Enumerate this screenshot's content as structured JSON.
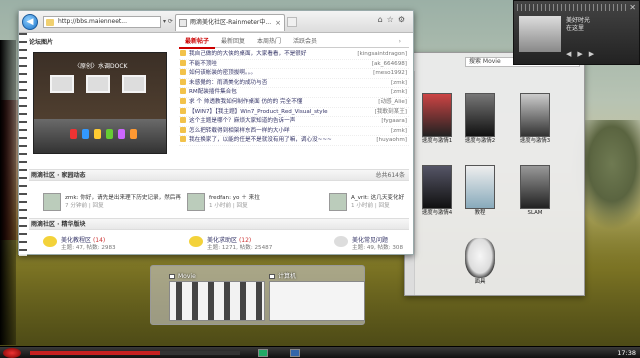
{
  "browser": {
    "address_value": "http://bbs.maienneet...",
    "tab_title": "雨滴美化社区-Rainmeter中...",
    "left_section_title": "论坛图片",
    "gallery_caption": "〈原创〉水调DOCK",
    "tabs": [
      {
        "label": "最新帖子",
        "active": true
      },
      {
        "label": "最新回复",
        "active": false
      },
      {
        "label": "本周热门",
        "active": false
      },
      {
        "label": "活跃会员",
        "active": false
      }
    ],
    "posts": [
      {
        "title": "我自己做的的大侠的桌面，大家看看，不是很好",
        "user": "[kingsaintdragon]"
      },
      {
        "title": "不能不顶哇",
        "user": "[ak_664698]"
      },
      {
        "title": "如何该帐装的密顶拔啊。。。",
        "user": "[meso1992]"
      },
      {
        "title": "未感覺的：雨滴美化的成功与否",
        "user": "[zmk]"
      },
      {
        "title": "RM配装插件集合包",
        "user": "[zmk]"
      },
      {
        "title": "求 个 帅透教我如何制作桌面 仿的的 完全不懂",
        "user": "[动感_Alie]"
      },
      {
        "title": "【WIN7】【我主题】Win7_Product_Red_Visual_style",
        "user": "[我歌刻某王]"
      },
      {
        "title": "这个主题是哪个？麻烦大家知道的告诉一声",
        "user": "[fygaara]"
      },
      {
        "title": "怎么把转载得到相架样东西一样的大小咩",
        "user": "[zmk]"
      },
      {
        "title": "我在换家了，以能的任是不是就没有用了嘛，调心没~~~",
        "user": "[huyaohm]"
      }
    ],
    "dynamics_bar": {
      "title": "雨滴社区 · 家园动态",
      "right": "总共614条"
    },
    "dynamics": [
      {
        "text": "zmk: 你好，请先是出来理下历史记录，然后再",
        "meta": "7 分钟前 | 回复"
      },
      {
        "text": "fredfan: yo ＋ 来拉",
        "meta": "1 小时前 | 回复"
      },
      {
        "text": "A_vrit: 这几天变化好",
        "meta": "1 小时前 | 回复"
      }
    ],
    "categories_bar": {
      "title": "雨滴社区 · 精华版块"
    },
    "categories": [
      {
        "name": "美化教程区",
        "count": "(14)",
        "stats": "主题: 47, 帖数: 2983"
      },
      {
        "name": "美化求助区",
        "count": "(12)",
        "stats": "主题: 1271, 帖数: 25487"
      },
      {
        "name": "美化常见问题",
        "count": "",
        "stats": "主题: 49, 帖数: 308"
      }
    ]
  },
  "explorer": {
    "path": "搜索 Movie",
    "items": [
      {
        "label": "速度与激情1"
      },
      {
        "label": "速度与激情2"
      },
      {
        "label": "速度与激情3"
      },
      {
        "label": "速度与激情4"
      },
      {
        "label": "教程"
      },
      {
        "label": "SLAM"
      },
      {
        "label": "面具"
      }
    ]
  },
  "media": {
    "title": "美好时光",
    "artist": "在这里"
  },
  "taskbar": {
    "preview_movie": "Movie",
    "preview_computer": "计算机",
    "clock": "17:38",
    "progress": 0.62
  },
  "colors": {
    "accent": "#c00000",
    "link": "#333366"
  }
}
